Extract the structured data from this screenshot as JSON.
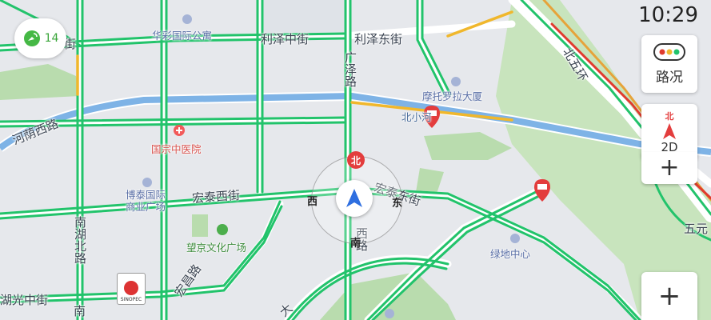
{
  "status": {
    "time": "10:29",
    "gps_count": "14"
  },
  "controls": {
    "traffic_label": "路况",
    "mode_north": "北",
    "mode_label": "2D",
    "zoom_in": "+",
    "zoom_out": "+"
  },
  "compass": {
    "north": "北",
    "south": "南",
    "east": "东",
    "west": "西"
  },
  "roads": {
    "lize_zhong": "利泽中街",
    "lize_dong": "利泽东街",
    "guangze": "广泽路",
    "hongtai_xi": "宏泰西街",
    "hongtai_dong": "宏泰东街",
    "nanhu_bei": "南湖北路",
    "hongchang": "宏昌路",
    "huguang_zhong": "湖光中街",
    "hedong": "河荫西路",
    "jie": "街",
    "guangshun_south": "西路",
    "expressway": "北五环",
    "wuhuan": "五元",
    "nan": "南",
    "da": "大"
  },
  "pois": {
    "huacai": "华彩国际公寓",
    "motorola": "摩托罗拉大厦",
    "guozong": "国宗中医院",
    "botai": "博泰国际商业广场",
    "wangjing_culture": "望京文化广场",
    "green_center": "绿地中心",
    "river": "北小河",
    "sinopec": "SINOPEC"
  },
  "colors": {
    "road_fill": "#ffffff",
    "traffic_green": "#22c36b",
    "traffic_yellow": "#f0b72c",
    "traffic_red": "#e03b2e",
    "river": "#5c9bd6",
    "park": "#b9dcae",
    "nav_arrow": "#2f6fe0"
  }
}
